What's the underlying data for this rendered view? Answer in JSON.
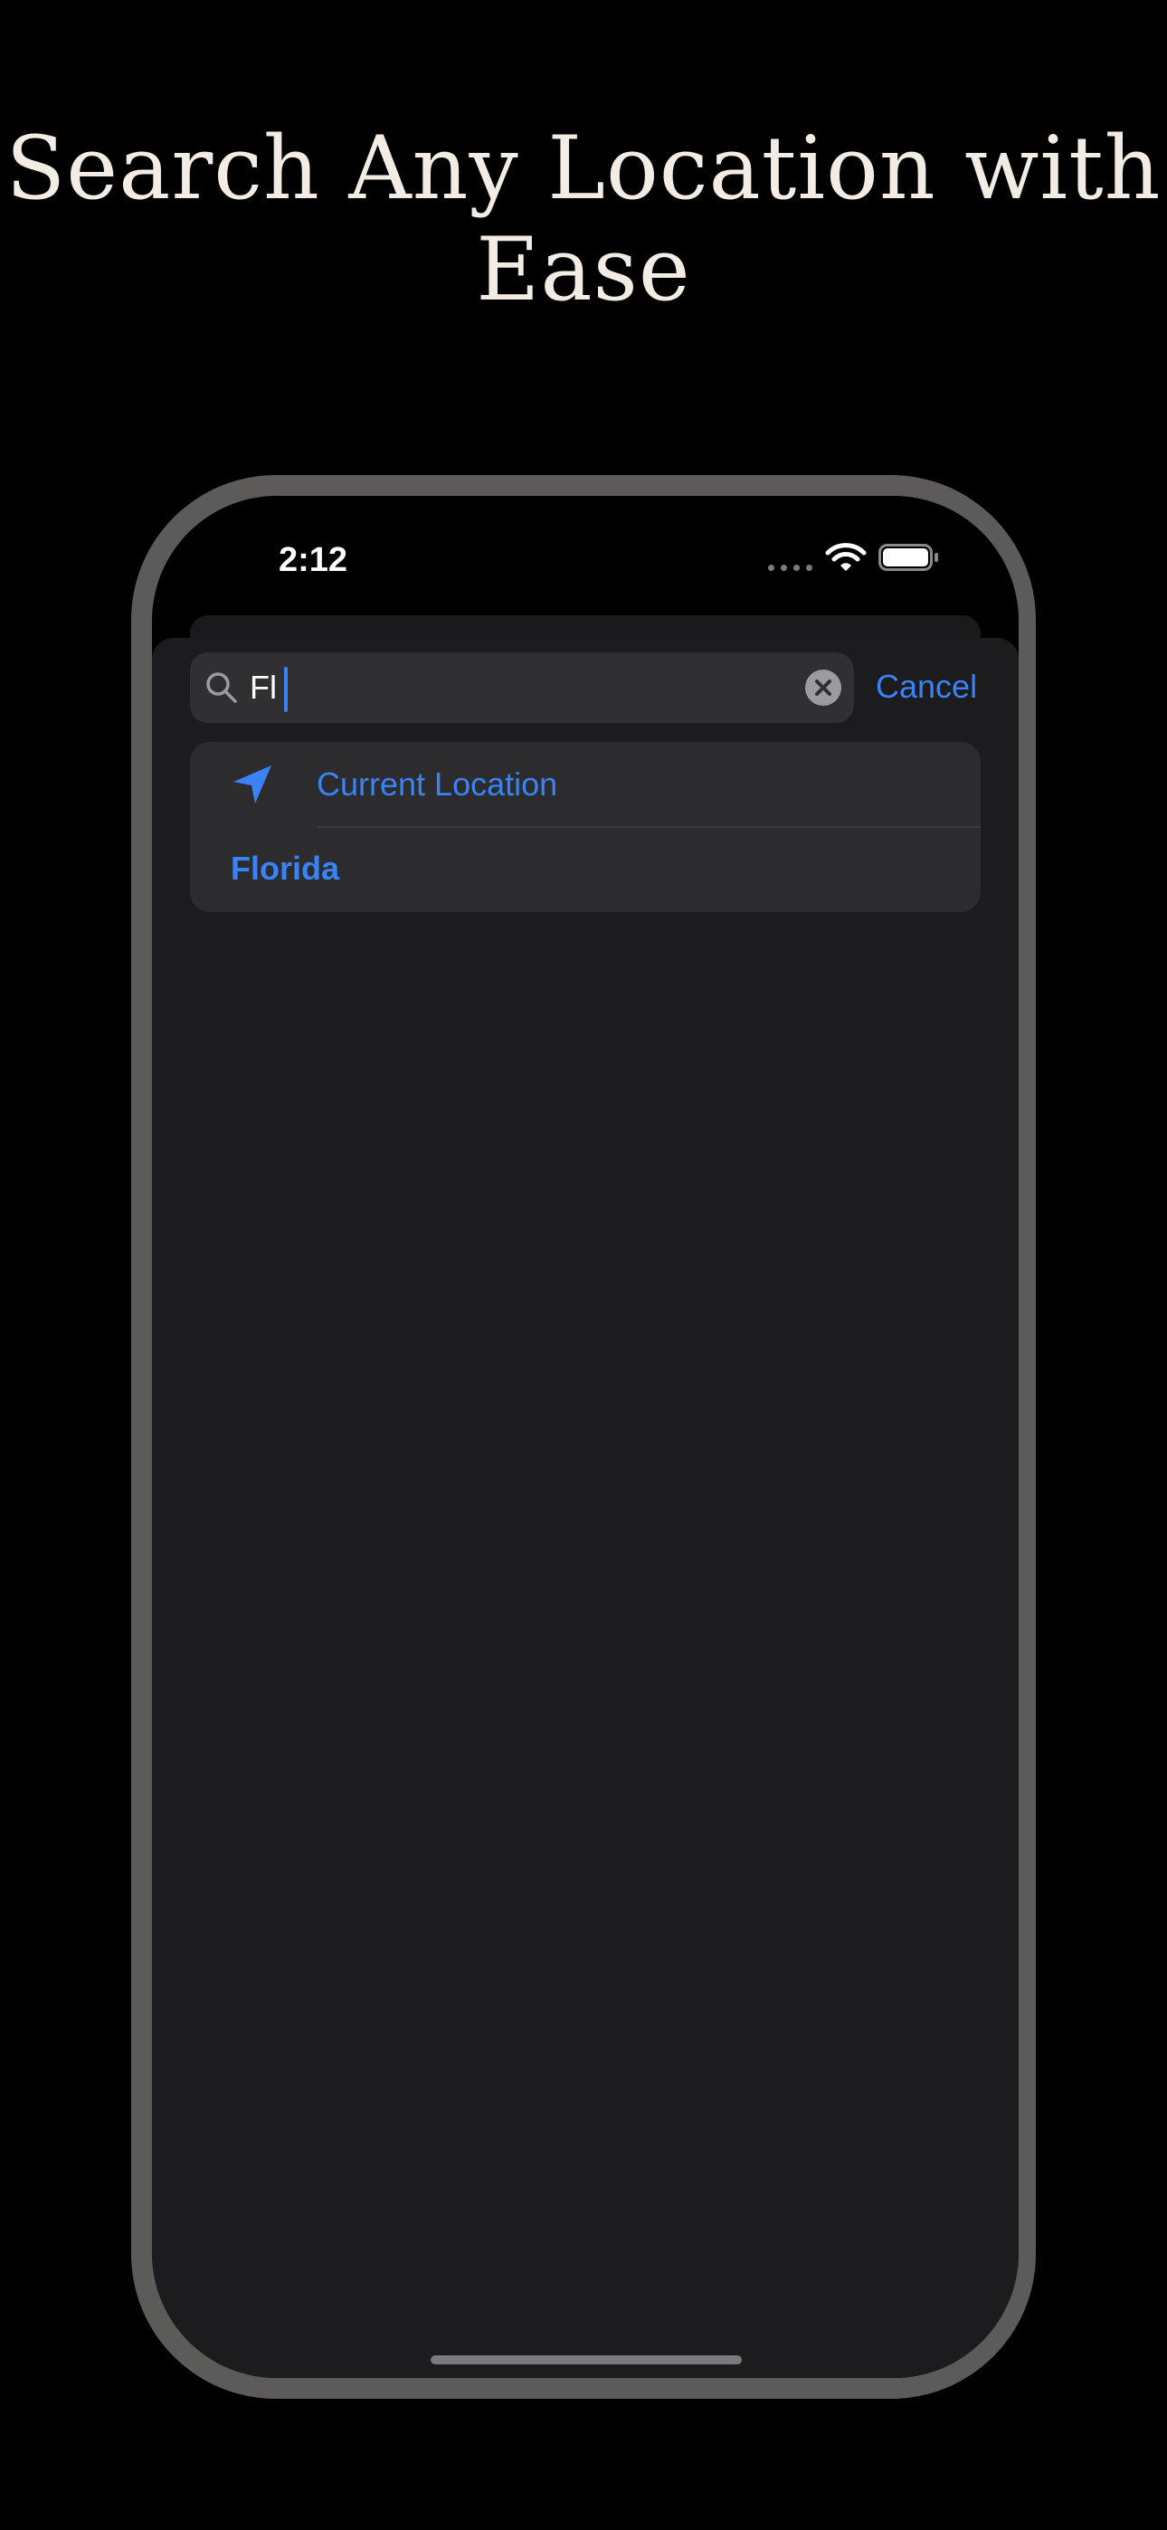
{
  "promo": {
    "headline_line1": "Search Any Location with",
    "headline_line2": "Ease"
  },
  "status_bar": {
    "time": "2:12",
    "icons": [
      "signal-dots-icon",
      "wifi-icon",
      "battery-icon"
    ]
  },
  "search": {
    "value": "Fl",
    "cancel_label": "Cancel",
    "icons": [
      "search-icon",
      "clear-icon"
    ]
  },
  "results": {
    "current_location_label": "Current Location",
    "current_location_icon": "location-arrow-icon",
    "items": [
      {
        "label": "Florida"
      }
    ]
  },
  "colors": {
    "accent": "#3a82f7",
    "background": "#000000",
    "frame": "#5d5a5a",
    "sheet": "#1c1c1e",
    "card": "#2c2c2e",
    "search_field": "#303033",
    "headline": "#f3ece4"
  }
}
